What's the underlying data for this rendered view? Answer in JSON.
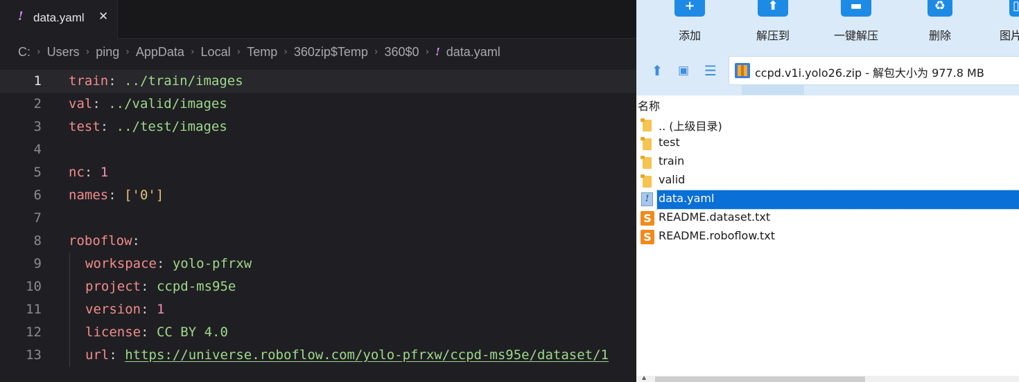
{
  "editor": {
    "tab": {
      "icon": "!",
      "title": "data.yaml",
      "close": "✕"
    },
    "breadcrumb": [
      "C:",
      "Users",
      "ping",
      "AppData",
      "Local",
      "Temp",
      "360zip$Temp",
      "360$0"
    ],
    "breadcrumb_file": "data.yaml",
    "breadcrumb_file_icon": "!",
    "breadcrumb_separator": "›",
    "current_line": 1,
    "lines": [
      {
        "no": "1",
        "key": "train",
        "colon": ": ",
        "value": "../train/images",
        "vt": "s",
        "indent": false
      },
      {
        "no": "2",
        "key": "val",
        "colon": ": ",
        "value": "../valid/images",
        "vt": "s",
        "indent": false
      },
      {
        "no": "3",
        "key": "test",
        "colon": ": ",
        "value": "../test/images",
        "vt": "s",
        "indent": false
      },
      {
        "no": "4",
        "key": "",
        "colon": "",
        "value": "",
        "vt": "s",
        "indent": false
      },
      {
        "no": "5",
        "key": "nc",
        "colon": ": ",
        "value": "1",
        "vt": "n",
        "indent": false
      },
      {
        "no": "6",
        "key": "names",
        "colon": ": ",
        "value": "['0']",
        "vt": "b",
        "indent": false
      },
      {
        "no": "7",
        "key": "",
        "colon": "",
        "value": "",
        "vt": "s",
        "indent": false
      },
      {
        "no": "8",
        "key": "roboflow",
        "colon": ":",
        "value": "",
        "vt": "s",
        "indent": false
      },
      {
        "no": "9",
        "key": "workspace",
        "colon": ": ",
        "value": "yolo-pfrxw",
        "vt": "s",
        "indent": true
      },
      {
        "no": "10",
        "key": "project",
        "colon": ": ",
        "value": "ccpd-ms95e",
        "vt": "s",
        "indent": true
      },
      {
        "no": "11",
        "key": "version",
        "colon": ": ",
        "value": "1",
        "vt": "n",
        "indent": true
      },
      {
        "no": "12",
        "key": "license",
        "colon": ": ",
        "value": "CC BY 4.0",
        "vt": "s",
        "indent": true
      },
      {
        "no": "13",
        "key": "url",
        "colon": ": ",
        "value": "https://universe.roboflow.com/yolo-pfrxw/ccpd-ms95e/dataset/1",
        "vt": "u",
        "indent": true
      }
    ]
  },
  "zip": {
    "toolbar": [
      {
        "label": "添加",
        "icon": "add-icon",
        "glyph": "+"
      },
      {
        "label": "解压到",
        "icon": "extract-to-icon",
        "glyph": "⬆"
      },
      {
        "label": "一键解压",
        "icon": "one-click-extract-icon",
        "glyph": "▬"
      },
      {
        "label": "删除",
        "icon": "delete-icon",
        "glyph": "♻"
      },
      {
        "label": "图片",
        "icon": "image-icon",
        "glyph": "▯"
      }
    ],
    "address": "ccpd.v1i.yolo26.zip - 解包大小为 977.8 MB",
    "column_header": "名称",
    "files": [
      {
        "name": ".. (上级目录)",
        "type": "folder"
      },
      {
        "name": "test",
        "type": "folder"
      },
      {
        "name": "train",
        "type": "folder"
      },
      {
        "name": "valid",
        "type": "folder"
      },
      {
        "name": "data.yaml",
        "type": "yaml",
        "selected": true
      },
      {
        "name": "README.dataset.txt",
        "type": "text"
      },
      {
        "name": "README.roboflow.txt",
        "type": "text"
      }
    ],
    "colors": {
      "toolbar_bg": "#dbeaf8",
      "accent": "#1d8ae6",
      "selection": "#0a6fd6"
    }
  }
}
